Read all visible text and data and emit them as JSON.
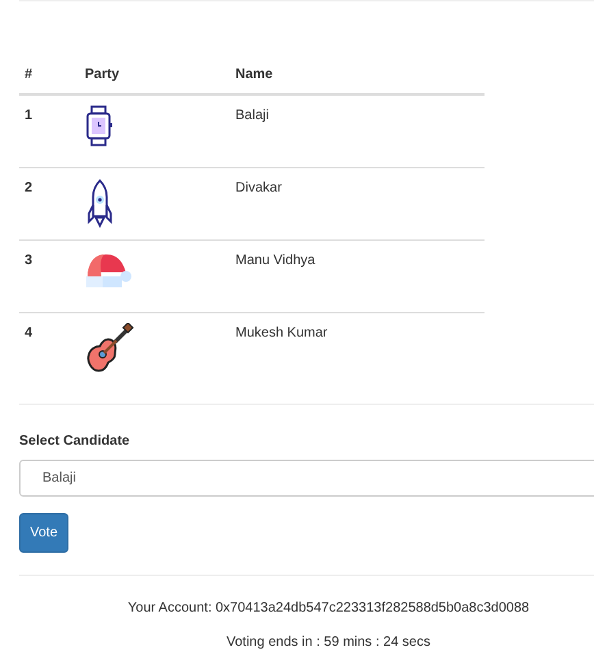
{
  "table": {
    "columns": [
      "#",
      "Party",
      "Name"
    ],
    "rows": [
      {
        "number": "1",
        "party": {
          "kind": "watch"
        },
        "name": "Balaji"
      },
      {
        "number": "2",
        "party": {
          "kind": "rocket"
        },
        "name": "Divakar"
      },
      {
        "number": "3",
        "party": {
          "kind": "hat"
        },
        "name": "Manu Vidhya"
      },
      {
        "number": "4",
        "party": {
          "kind": "guitar"
        },
        "name": "Mukesh Kumar"
      }
    ]
  },
  "form": {
    "label": "Select Candidate",
    "select_value": "Balaji",
    "button": "Vote"
  },
  "footer": {
    "account": "Your Account: 0x70413a24db547c223313f282588d5b0a8c3d0088",
    "timer": "Voting ends in : 59 mins : 24 secs"
  }
}
